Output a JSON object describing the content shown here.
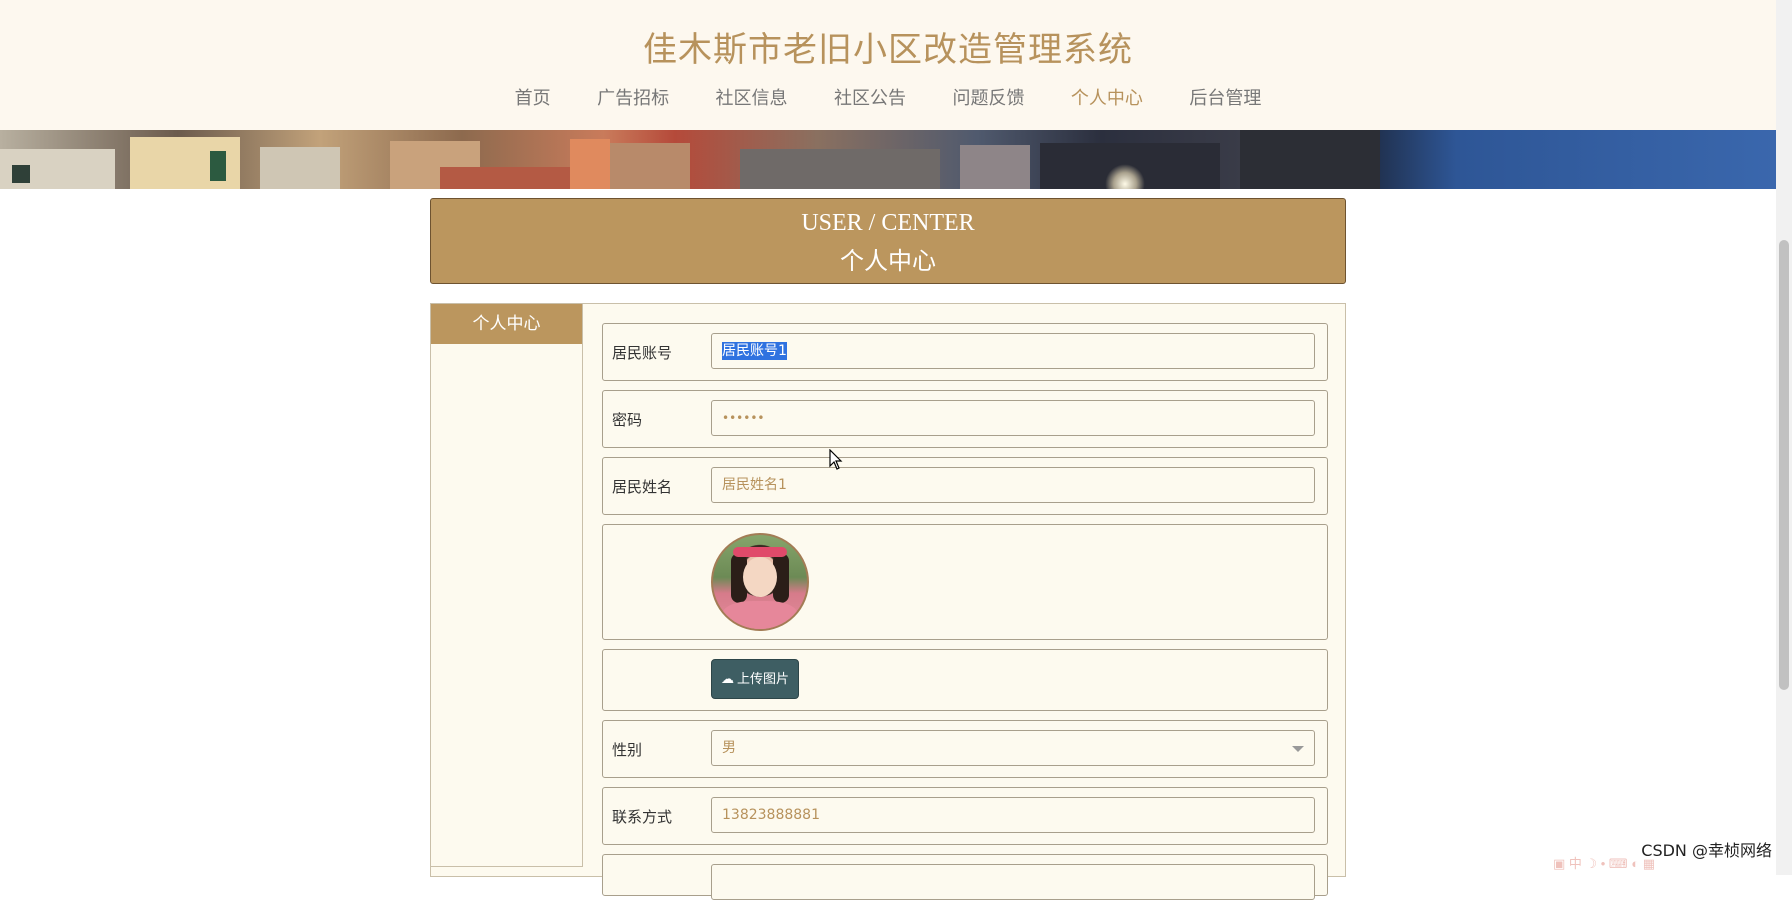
{
  "site": {
    "title": "佳木斯市老旧小区改造管理系统"
  },
  "nav": {
    "items": [
      {
        "label": "首页"
      },
      {
        "label": "广告招标"
      },
      {
        "label": "社区信息"
      },
      {
        "label": "社区公告"
      },
      {
        "label": "问题反馈"
      },
      {
        "label": "个人中心"
      },
      {
        "label": "后台管理"
      }
    ],
    "active": "个人中心"
  },
  "center_banner": {
    "en": "USER / CENTER",
    "cn": "个人中心"
  },
  "sidebar": {
    "title": "个人中心"
  },
  "form": {
    "account": {
      "label": "居民账号",
      "value": "居民账号1"
    },
    "password": {
      "label": "密码",
      "value": "••••••"
    },
    "name": {
      "label": "居民姓名",
      "value": "居民姓名1"
    },
    "upload": {
      "label": "上传图片"
    },
    "gender": {
      "label": "性别",
      "value": "男"
    },
    "phone": {
      "label": "联系方式",
      "value": "13823888881"
    }
  },
  "watermark": "CSDN @幸桢网络",
  "colors": {
    "accent": "#bb965e",
    "title": "#b7925c",
    "button": "#3e5e63",
    "header_bg": "#fdf8ef",
    "panel_bg": "#fdfaef"
  }
}
